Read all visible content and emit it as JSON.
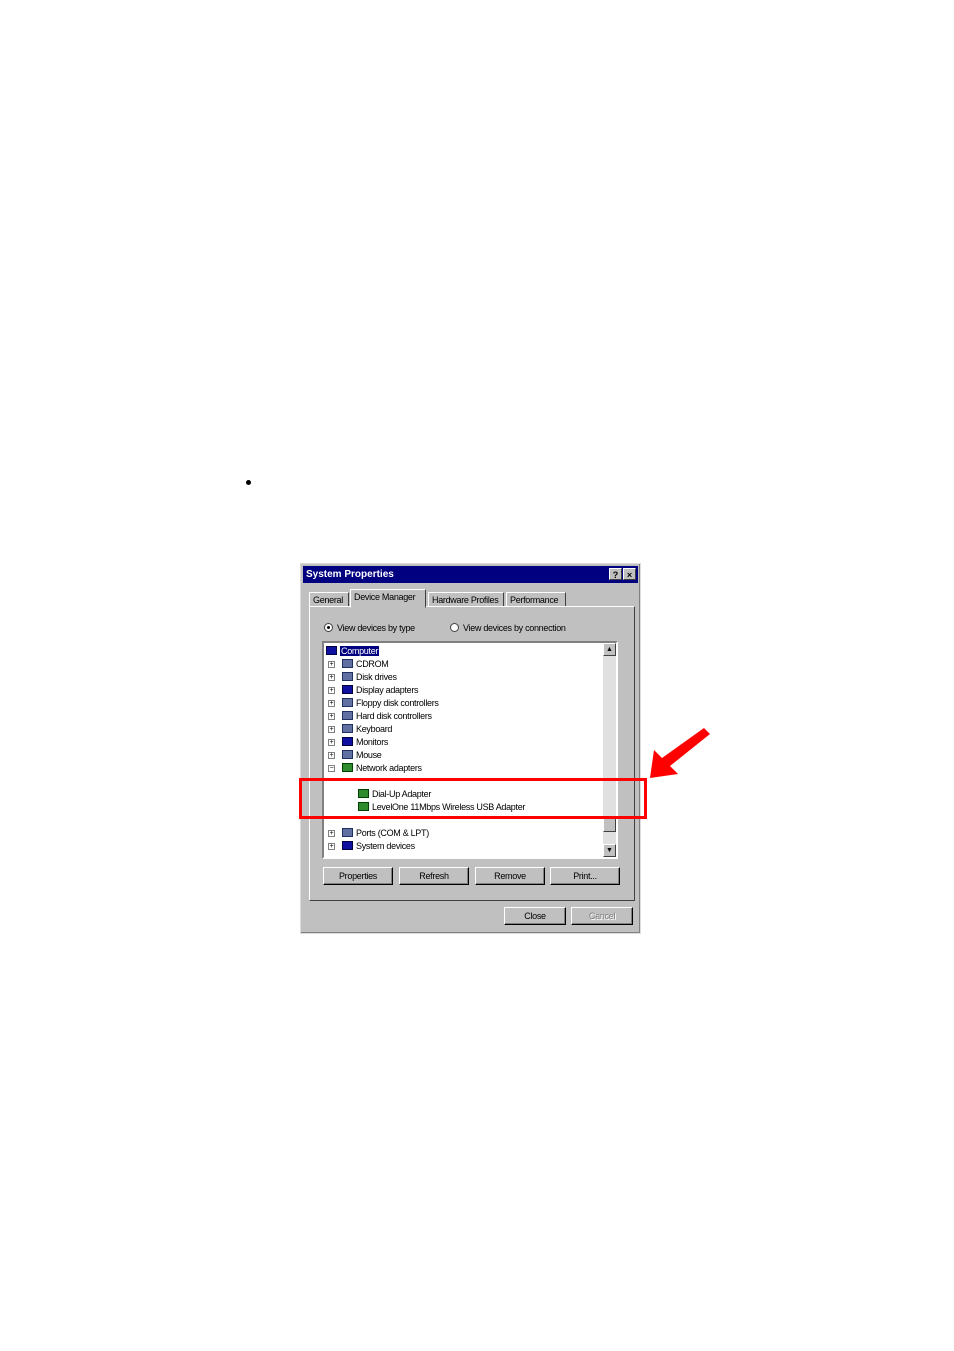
{
  "window": {
    "title": "System Properties",
    "help_btn": "?",
    "close_btn": "×"
  },
  "tabs": [
    "General",
    "Device Manager",
    "Hardware Profiles",
    "Performance"
  ],
  "view_options": {
    "by_type": "View devices by type",
    "by_connection": "View devices by connection",
    "selected": "by_type"
  },
  "tree": {
    "root": "Computer",
    "items": [
      {
        "label": "CDROM",
        "expander": "+"
      },
      {
        "label": "Disk drives",
        "expander": "+"
      },
      {
        "label": "Display adapters",
        "expander": "+"
      },
      {
        "label": "Floppy disk controllers",
        "expander": "+"
      },
      {
        "label": "Hard disk controllers",
        "expander": "+"
      },
      {
        "label": "Keyboard",
        "expander": "+"
      },
      {
        "label": "Monitors",
        "expander": "+"
      },
      {
        "label": "Mouse",
        "expander": "+"
      },
      {
        "label": "Network adapters",
        "expander": "−"
      },
      {
        "label": "Dial-Up Adapter",
        "child": true
      },
      {
        "label": "LevelOne 11Mbps Wireless USB Adapter",
        "child": true
      },
      {
        "label": "Ports (COM & LPT)",
        "expander": "+"
      },
      {
        "label": "System devices",
        "expander": "+"
      }
    ]
  },
  "buttons": {
    "properties": "Properties",
    "refresh": "Refresh",
    "remove": "Remove",
    "print": "Print...",
    "close": "Close",
    "cancel": "Cancel"
  },
  "colors": {
    "highlight": "#ff0000",
    "titlebar": "#000080"
  }
}
